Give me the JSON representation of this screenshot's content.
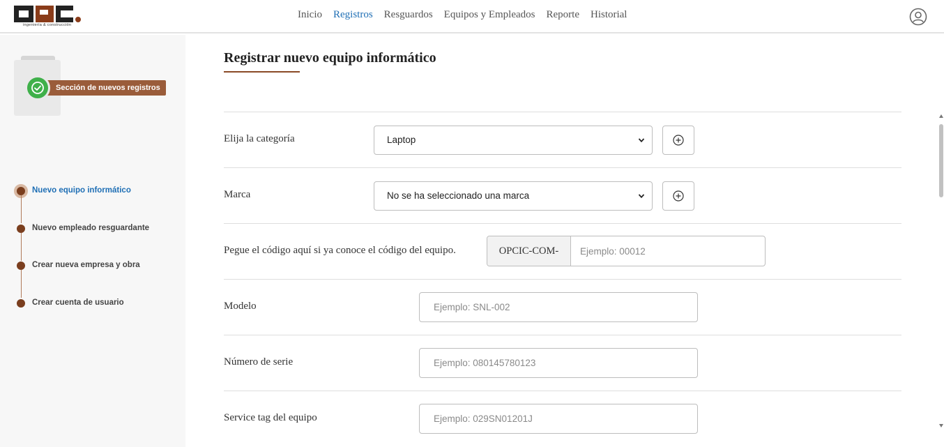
{
  "brand": {
    "logo_letters": "OPC",
    "tagline": "ingeniería & construcción",
    "colors": {
      "black": "#222222",
      "brown": "#8a3c1a",
      "accent": "#1f6fb5"
    }
  },
  "nav": {
    "items": [
      {
        "label": "Inicio",
        "active": false
      },
      {
        "label": "Registros",
        "active": true
      },
      {
        "label": "Resguardos",
        "active": false
      },
      {
        "label": "Equipos y Empleados",
        "active": false
      },
      {
        "label": "Reporte",
        "active": false
      },
      {
        "label": "Historial",
        "active": false
      }
    ],
    "user_icon": "user-circle-icon"
  },
  "sidebar": {
    "badge_label": "Sección de nuevos registros",
    "badge_icon": "check-circle-icon",
    "steps": [
      {
        "label": "Nuevo equipo informático",
        "active": true
      },
      {
        "label": "Nuevo empleado resguardante",
        "active": false
      },
      {
        "label": "Crear nueva empresa y obra",
        "active": false
      },
      {
        "label": "Crear cuenta de usuario",
        "active": false
      }
    ]
  },
  "main": {
    "title": "Registrar nuevo equipo informático",
    "form": {
      "category": {
        "label": "Elija la categoría",
        "value": "Laptop"
      },
      "brand": {
        "label": "Marca",
        "value": "No se ha seleccionado una marca"
      },
      "code": {
        "label": "Pegue el código aquí si ya conoce el código del equipo.",
        "prefix": "OPCIC-COM-",
        "placeholder": "Ejemplo: 00012"
      },
      "model": {
        "label": "Modelo",
        "placeholder": "Ejemplo: SNL-002"
      },
      "serial": {
        "label": "Número de serie",
        "placeholder": "Ejemplo: 080145780123"
      },
      "service_tag": {
        "label": "Service tag del equipo",
        "placeholder": "Ejemplo: 029SN01201J"
      }
    }
  }
}
